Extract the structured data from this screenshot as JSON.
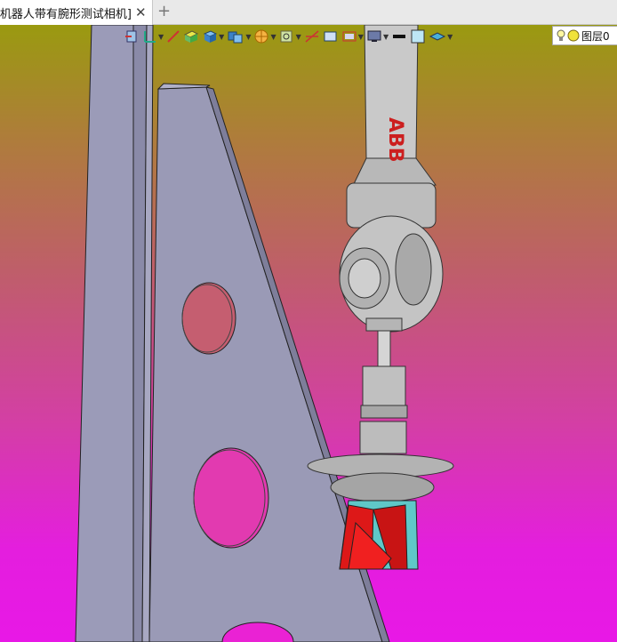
{
  "tab": {
    "title": "[测试机器人带有腕形测试相机]",
    "close_glyph": "✕",
    "add_glyph": "+"
  },
  "toolbar": {
    "items": [
      "exit-icon",
      "axis-icon",
      "wand-icon",
      "box-icon",
      "cube-icon",
      "multi-cube-icon",
      "render-icon",
      "zoom-icon",
      "lines-icon",
      "frame-icon",
      "screen-icon",
      "line-weight-icon",
      "color-swatch-icon",
      "layers-stack-icon"
    ],
    "layer_label": "图层0"
  },
  "scene": {
    "robot_brand": "ABB"
  },
  "colors": {
    "background_top": "#9a9a10",
    "background_bottom": "#e818e6",
    "frame": "#9b9bb8",
    "robot": "#c8c8c8",
    "gripper": "#dd1818"
  }
}
